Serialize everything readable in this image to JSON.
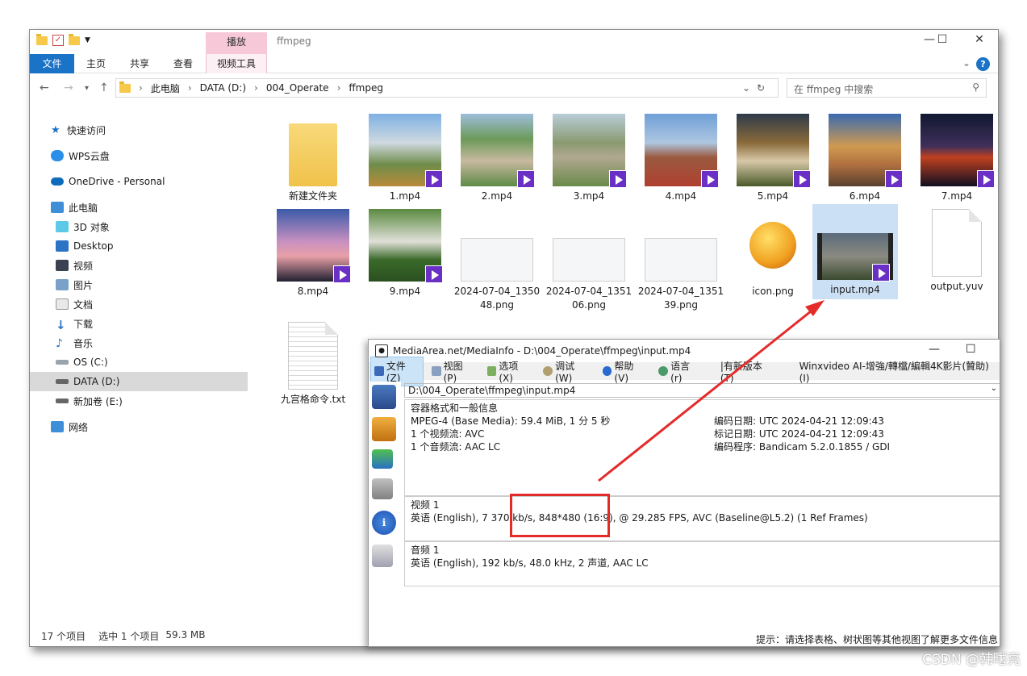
{
  "explorer": {
    "title": "ffmpeg",
    "ribbon_context": "播放",
    "tabs": [
      "文件",
      "主页",
      "共享",
      "查看",
      "视频工具"
    ],
    "breadcrumb": [
      "此电脑",
      "DATA (D:)",
      "004_Operate",
      "ffmpeg"
    ],
    "search_placeholder": "在 ffmpeg 中搜索",
    "sidebar": [
      {
        "label": "快速访问",
        "icon": "star-icon"
      },
      {
        "label": "WPS云盘",
        "icon": "cloud-icon"
      },
      {
        "label": "OneDrive - Personal",
        "icon": "onedrive-icon"
      },
      {
        "label": "此电脑",
        "icon": "computer-icon"
      },
      {
        "label": "3D 对象",
        "icon": "cube-icon"
      },
      {
        "label": "Desktop",
        "icon": "desktop-icon"
      },
      {
        "label": "视频",
        "icon": "video-folder-icon"
      },
      {
        "label": "图片",
        "icon": "pictures-folder-icon"
      },
      {
        "label": "文档",
        "icon": "documents-folder-icon"
      },
      {
        "label": "下载",
        "icon": "download-icon"
      },
      {
        "label": "音乐",
        "icon": "music-icon"
      },
      {
        "label": "OS (C:)",
        "icon": "drive-icon"
      },
      {
        "label": "DATA (D:)",
        "icon": "drive-icon"
      },
      {
        "label": "新加卷 (E:)",
        "icon": "drive-icon"
      },
      {
        "label": "网络",
        "icon": "network-icon"
      }
    ],
    "files": [
      {
        "name": "新建文件夹",
        "kind": "folder"
      },
      {
        "name": "1.mp4",
        "kind": "video"
      },
      {
        "name": "2.mp4",
        "kind": "video"
      },
      {
        "name": "3.mp4",
        "kind": "video"
      },
      {
        "name": "4.mp4",
        "kind": "video"
      },
      {
        "name": "5.mp4",
        "kind": "video"
      },
      {
        "name": "6.mp4",
        "kind": "video"
      },
      {
        "name": "7.mp4",
        "kind": "video"
      },
      {
        "name": "8.mp4",
        "kind": "video"
      },
      {
        "name": "9.mp4",
        "kind": "video"
      },
      {
        "name": "2024-07-04_135048.png",
        "kind": "image"
      },
      {
        "name": "2024-07-04_135106.png",
        "kind": "image"
      },
      {
        "name": "2024-07-04_135139.png",
        "kind": "image"
      },
      {
        "name": "icon.png",
        "kind": "image"
      },
      {
        "name": "input.mp4",
        "kind": "video"
      },
      {
        "name": "output.yuv",
        "kind": "blank"
      },
      {
        "name": "九宫格命令.txt",
        "kind": "text"
      }
    ],
    "status": {
      "count": "17 个项目",
      "selected": "选中 1 个项目",
      "size": "59.3 MB"
    }
  },
  "mediainfo": {
    "title": "MediaArea.net/MediaInfo - D:\\004_Operate\\ffmpeg\\input.mp4",
    "menus": [
      "文件(Z)",
      "视图(P)",
      "选项(X)",
      "调试(W)",
      "帮助(V)",
      "语言(r)",
      "|有新版本(T)",
      "Winxvideo AI-增強/轉檔/編輯4K影片(贊助)(I)"
    ],
    "file_path": "D:\\004_Operate\\ffmpeg\\input.mp4",
    "general": {
      "heading": "容器格式和一般信息",
      "left": [
        "MPEG-4 (Base Media): 59.4 MiB, 1 分 5 秒",
        "1 个视频流: AVC",
        "1 个音频流: AAC LC"
      ],
      "right": [
        "编码日期: UTC 2024-04-21 12:09:43",
        "标记日期: UTC 2024-04-21 12:09:43",
        "编码程序: Bandicam 5.2.0.1855 / GDI"
      ]
    },
    "video": {
      "heading": "视频 1",
      "line": "英语 (English), 7 370 kb/s, 848*480 (16:9), @ 29.285 FPS, AVC (Baseline@L5.2) (1 Ref Frames)"
    },
    "audio": {
      "heading": "音频 1",
      "line": "英语 (English), 192 kb/s, 48.0 kHz, 2 声道, AAC LC"
    },
    "hint": "提示：请选择表格、树状图等其他视图了解更多文件信息"
  },
  "watermark": "CSDN @韩曙亮",
  "colors": {
    "accent": "#1a73c7",
    "video_badge": "#6a2fc4",
    "annotation": "#e52a2a"
  }
}
